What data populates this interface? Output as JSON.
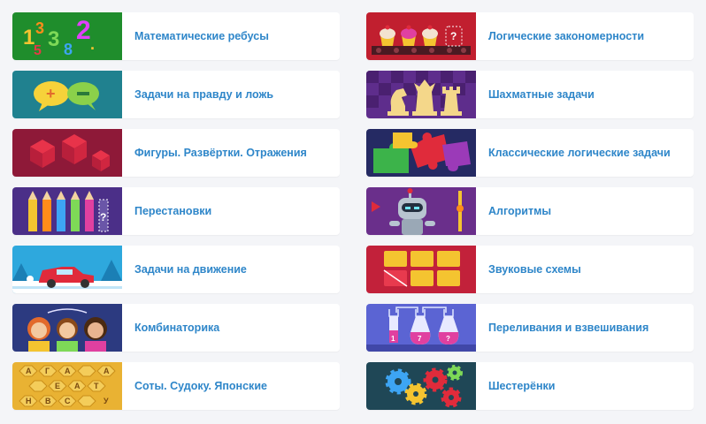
{
  "left": [
    {
      "label": "Математические ребусы",
      "icon": "colorful-numbers-icon",
      "color": "#1f8d2c"
    },
    {
      "label": "Задачи на правду и ложь",
      "icon": "plus-minus-speech-bubbles-icon",
      "color": "#20818f"
    },
    {
      "label": "Фигуры. Развёртки. Отражения",
      "icon": "red-3d-cubes-icon",
      "color": "#8e1938"
    },
    {
      "label": "Перестановки",
      "icon": "colored-pencils-icon",
      "color": "#4b2f88"
    },
    {
      "label": "Задачи на движение",
      "icon": "red-car-icon",
      "color": "#2ea8dd"
    },
    {
      "label": "Комбинаторика",
      "icon": "three-kids-icon",
      "color": "#2c3a80"
    },
    {
      "label": "Соты. Судоку. Японские",
      "icon": "honeycomb-letters-icon",
      "color": "#e9b233"
    }
  ],
  "right": [
    {
      "label": "Логические закономерности",
      "icon": "cupcakes-conveyor-icon",
      "color": "#c11f2f"
    },
    {
      "label": "Шахматные задачи",
      "icon": "chess-pieces-icon",
      "color": "#5e2d8c"
    },
    {
      "label": "Классические логические задачи",
      "icon": "jigsaw-puzzle-icon",
      "color": "#252a63"
    },
    {
      "label": "Алгоритмы",
      "icon": "robot-icon",
      "color": "#6a2f8b"
    },
    {
      "label": "Звуковые схемы",
      "icon": "sound-scheme-blocks-icon",
      "color": "#c2213a"
    },
    {
      "label": "Переливания и взвешивания",
      "icon": "flasks-icon",
      "color": "#5b64d3"
    },
    {
      "label": "Шестерёнки",
      "icon": "gears-icon",
      "color": "#1f4756"
    }
  ]
}
